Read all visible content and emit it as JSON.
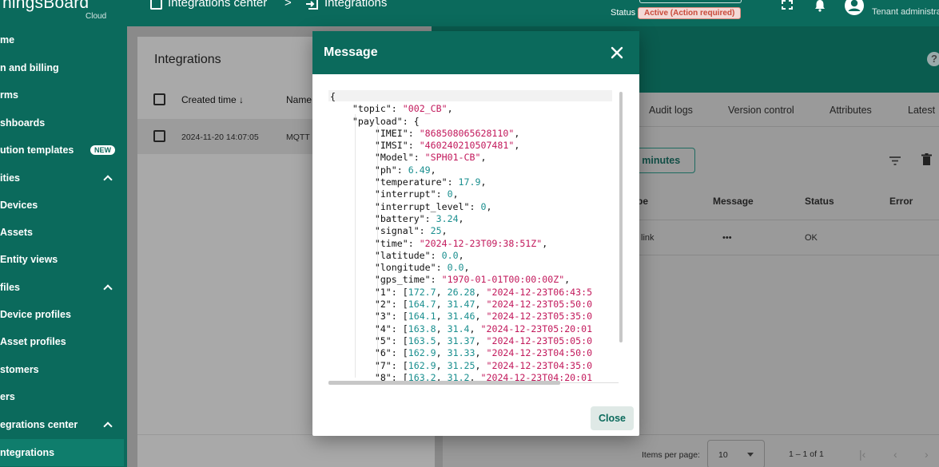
{
  "topbar": {
    "logo": "ThingsBoard",
    "logo_sub": "Cloud",
    "breadcrumb": [
      "Integrations center",
      "Integrations"
    ],
    "breadcrumb_sep": ">",
    "status_label": "Status",
    "status_badge": "Active (Action required)",
    "user_role": "Tenant administrator"
  },
  "sidebar": {
    "items": [
      {
        "label": "me"
      },
      {
        "label": "n and billing"
      },
      {
        "label": "rms"
      },
      {
        "label": "shboards"
      },
      {
        "label": "ution templates",
        "badge": "NEW"
      },
      {
        "label": "ities"
      },
      {
        "label": "Devices"
      },
      {
        "label": "Assets"
      },
      {
        "label": "Entity views"
      },
      {
        "label": "files"
      },
      {
        "label": "Device profiles"
      },
      {
        "label": "Asset profiles"
      },
      {
        "label": "stomers"
      },
      {
        "label": "ers"
      },
      {
        "label": "egrations center"
      },
      {
        "label": "ntegrations"
      }
    ]
  },
  "integrations_list": {
    "title": "Integrations",
    "columns": [
      "Created time",
      "Name"
    ],
    "rows": [
      {
        "created": "2024-11-20 14:07:05",
        "name": "MQTT"
      }
    ]
  },
  "detail": {
    "tabs": [
      "Audit logs",
      "Version control",
      "Attributes",
      "Latest"
    ],
    "time_button": "5 minutes",
    "columns": [
      "pe",
      "Message",
      "Status",
      "Error"
    ],
    "rows": [
      {
        "type": "link",
        "message": "•••",
        "status": "OK"
      }
    ],
    "pager": {
      "items_per_page_label": "Items per page:",
      "items_per_page": "10",
      "range": "1 – 1 of 1"
    }
  },
  "dialog": {
    "title": "Message",
    "close_label": "Close",
    "json_lines": [
      [
        [
          "k",
          "{"
        ]
      ],
      [
        [
          "k",
          "    \"topic\": "
        ],
        [
          "s",
          "\"002_CB\""
        ],
        [
          "k",
          ","
        ]
      ],
      [
        [
          "k",
          "    \"payload\": {"
        ]
      ],
      [
        [
          "k",
          "        \"IMEI\": "
        ],
        [
          "s",
          "\"868508065628110\""
        ],
        [
          "k",
          ","
        ]
      ],
      [
        [
          "k",
          "        \"IMSI\": "
        ],
        [
          "s",
          "\"460240210507481\""
        ],
        [
          "k",
          ","
        ]
      ],
      [
        [
          "k",
          "        \"Model\": "
        ],
        [
          "s",
          "\"SPH01-CB\""
        ],
        [
          "k",
          ","
        ]
      ],
      [
        [
          "k",
          "        \"ph\": "
        ],
        [
          "n",
          "6.49"
        ],
        [
          "k",
          ","
        ]
      ],
      [
        [
          "k",
          "        \"temperature\": "
        ],
        [
          "n",
          "17.9"
        ],
        [
          "k",
          ","
        ]
      ],
      [
        [
          "k",
          "        \"interrupt\": "
        ],
        [
          "n",
          "0"
        ],
        [
          "k",
          ","
        ]
      ],
      [
        [
          "k",
          "        \"interrupt_level\": "
        ],
        [
          "n",
          "0"
        ],
        [
          "k",
          ","
        ]
      ],
      [
        [
          "k",
          "        \"battery\": "
        ],
        [
          "n",
          "3.24"
        ],
        [
          "k",
          ","
        ]
      ],
      [
        [
          "k",
          "        \"signal\": "
        ],
        [
          "n",
          "25"
        ],
        [
          "k",
          ","
        ]
      ],
      [
        [
          "k",
          "        \"time\": "
        ],
        [
          "s",
          "\"2024-12-23T09:38:51Z\""
        ],
        [
          "k",
          ","
        ]
      ],
      [
        [
          "k",
          "        \"latitude\": "
        ],
        [
          "n",
          "0.0"
        ],
        [
          "k",
          ","
        ]
      ],
      [
        [
          "k",
          "        \"longitude\": "
        ],
        [
          "n",
          "0.0"
        ],
        [
          "k",
          ","
        ]
      ],
      [
        [
          "k",
          "        \"gps_time\": "
        ],
        [
          "s",
          "\"1970-01-01T00:00:00Z\""
        ],
        [
          "k",
          ","
        ]
      ],
      [
        [
          "k",
          "        \"1\": ["
        ],
        [
          "n",
          "172.7"
        ],
        [
          "k",
          ", "
        ],
        [
          "n",
          "26.28"
        ],
        [
          "k",
          ", "
        ],
        [
          "s",
          "\"2024-12-23T06:43:5"
        ]
      ],
      [
        [
          "k",
          "        \"2\": ["
        ],
        [
          "n",
          "164.7"
        ],
        [
          "k",
          ", "
        ],
        [
          "n",
          "31.47"
        ],
        [
          "k",
          ", "
        ],
        [
          "s",
          "\"2024-12-23T05:50:0"
        ]
      ],
      [
        [
          "k",
          "        \"3\": ["
        ],
        [
          "n",
          "164.1"
        ],
        [
          "k",
          ", "
        ],
        [
          "n",
          "31.46"
        ],
        [
          "k",
          ", "
        ],
        [
          "s",
          "\"2024-12-23T05:35:0"
        ]
      ],
      [
        [
          "k",
          "        \"4\": ["
        ],
        [
          "n",
          "163.8"
        ],
        [
          "k",
          ", "
        ],
        [
          "n",
          "31.4"
        ],
        [
          "k",
          ", "
        ],
        [
          "s",
          "\"2024-12-23T05:20:01"
        ]
      ],
      [
        [
          "k",
          "        \"5\": ["
        ],
        [
          "n",
          "163.5"
        ],
        [
          "k",
          ", "
        ],
        [
          "n",
          "31.37"
        ],
        [
          "k",
          ", "
        ],
        [
          "s",
          "\"2024-12-23T05:05:0"
        ]
      ],
      [
        [
          "k",
          "        \"6\": ["
        ],
        [
          "n",
          "162.9"
        ],
        [
          "k",
          ", "
        ],
        [
          "n",
          "31.33"
        ],
        [
          "k",
          ", "
        ],
        [
          "s",
          "\"2024-12-23T04:50:0"
        ]
      ],
      [
        [
          "k",
          "        \"7\": ["
        ],
        [
          "n",
          "162.9"
        ],
        [
          "k",
          ", "
        ],
        [
          "n",
          "31.25"
        ],
        [
          "k",
          ", "
        ],
        [
          "s",
          "\"2024-12-23T04:35:0"
        ]
      ],
      [
        [
          "k",
          "        \"8\": ["
        ],
        [
          "n",
          "163.2"
        ],
        [
          "k",
          ", "
        ],
        [
          "n",
          "31.2"
        ],
        [
          "k",
          ", "
        ],
        [
          "s",
          "\"2024-12-23T04:20:01"
        ]
      ]
    ]
  },
  "colors": {
    "brand": "#0b6a5c",
    "json_string": "#c2185b",
    "json_number": "#1a8f8f",
    "status_badge": "#c94a3a"
  }
}
